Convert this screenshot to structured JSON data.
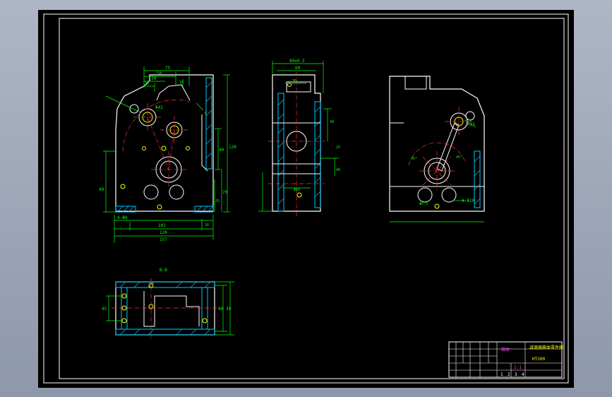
{
  "colors": {
    "background": "#000000",
    "frame": "#ffffff",
    "outline": "#ffffff",
    "dimension": "#00ff00",
    "centerline": "#ff3333",
    "hatch": "#00c8ff",
    "hole": "#ffff00",
    "table_text": "#ff40ff",
    "title_text": "#ffff00"
  },
  "front_view": {
    "top_dims": [
      "75",
      "50",
      "30",
      "10",
      "10"
    ],
    "diameter_label": "Φ42",
    "bottom_dims": [
      "4-Φ8",
      "102",
      "120",
      "157",
      "16"
    ],
    "left_dim": "49",
    "right_dims": [
      "40",
      "120",
      "70",
      "25",
      "6"
    ]
  },
  "side_view": {
    "top_dims": [
      "80±0.3",
      "60",
      "30"
    ],
    "right_dims": [
      "40",
      "25",
      "40"
    ],
    "bottom_dim": "Φ10"
  },
  "right_view": {
    "labels": [
      "R15",
      "4-Φ10",
      "Φ5.5",
      "45°",
      "45°"
    ]
  },
  "section_view": {
    "title": "B-B",
    "left_dim": "45",
    "right_dims": [
      "40",
      "30"
    ]
  },
  "title_block": {
    "part_name": "箱体",
    "drawing_title": "减速器箱体零件图",
    "material": "HT200",
    "scale": "1:1",
    "sheet_marks": [
      "1",
      "2",
      "3",
      "4"
    ]
  }
}
